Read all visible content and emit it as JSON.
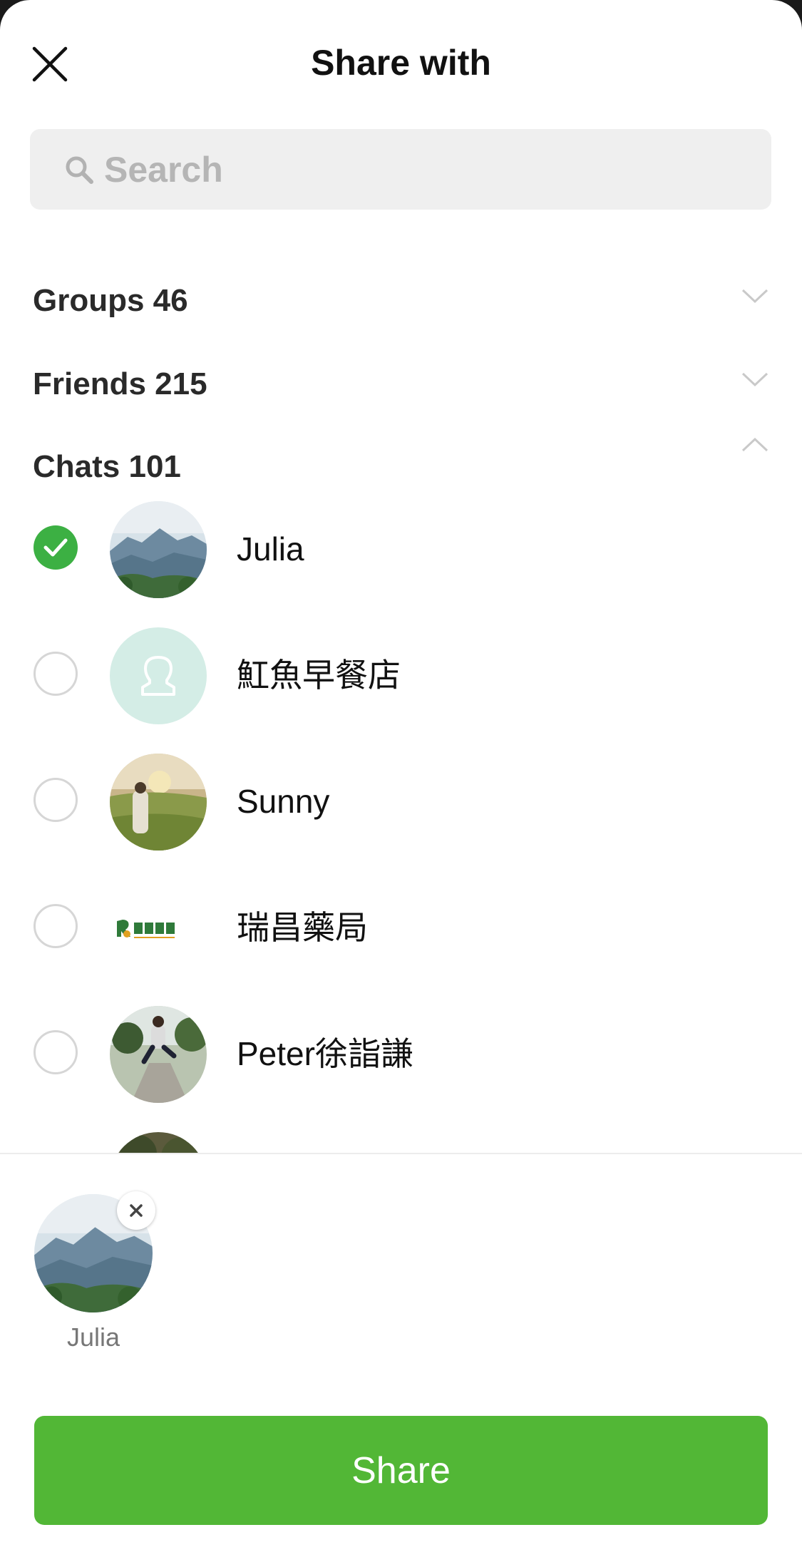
{
  "header": {
    "title": "Share with"
  },
  "search": {
    "placeholder": "Search"
  },
  "sections": {
    "groups": {
      "label": "Groups 46",
      "state": "collapsed"
    },
    "friends": {
      "label": "Friends 215",
      "state": "collapsed"
    },
    "chats": {
      "label": "Chats 101",
      "state": "expanded"
    }
  },
  "chats": [
    {
      "name": "Julia",
      "checked": true,
      "avatar": "landscape-photo"
    },
    {
      "name": "魟魚早餐店",
      "checked": false,
      "avatar": "default-person-icon"
    },
    {
      "name": "Sunny",
      "checked": false,
      "avatar": "person-photo"
    },
    {
      "name": "瑞昌藥局",
      "checked": false,
      "avatar": "pharmacy-logo"
    },
    {
      "name": "Peter徐詣謙",
      "checked": false,
      "avatar": "person-photo"
    }
  ],
  "selected": [
    {
      "name": "Julia"
    }
  ],
  "share_button": {
    "label": "Share"
  },
  "colors": {
    "accent": "#52b736",
    "check": "#3cb043",
    "search_bg": "#efefef",
    "default_avatar_bg": "#d4ede6"
  }
}
